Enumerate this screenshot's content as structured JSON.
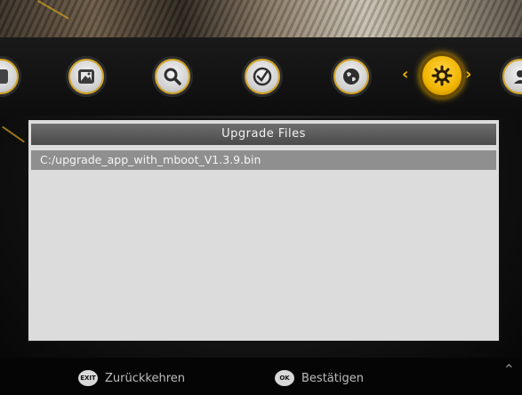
{
  "menu": {
    "icons": [
      {
        "name": "partial-icon-left"
      },
      {
        "name": "picture-icon"
      },
      {
        "name": "search-icon"
      },
      {
        "name": "clock-icon"
      },
      {
        "name": "globe-icon"
      },
      {
        "name": "gear-icon",
        "selected": true
      },
      {
        "name": "user-icon"
      }
    ],
    "left_arrow": "‹",
    "right_arrow": "›"
  },
  "panel": {
    "title": "Upgrade Files",
    "items": [
      "C:/upgrade_app_with_mboot_V1.3.9.bin"
    ]
  },
  "footer": {
    "exit_key": "EXIT",
    "exit_label": "Zurückkehren",
    "ok_key": "OK",
    "ok_label": "Bestätigen"
  },
  "colors": {
    "accent": "#f0b400",
    "panel_bg": "#dcdcdc",
    "title_bar": "#5a5a5a",
    "selected_row": "#8f8f8f"
  }
}
